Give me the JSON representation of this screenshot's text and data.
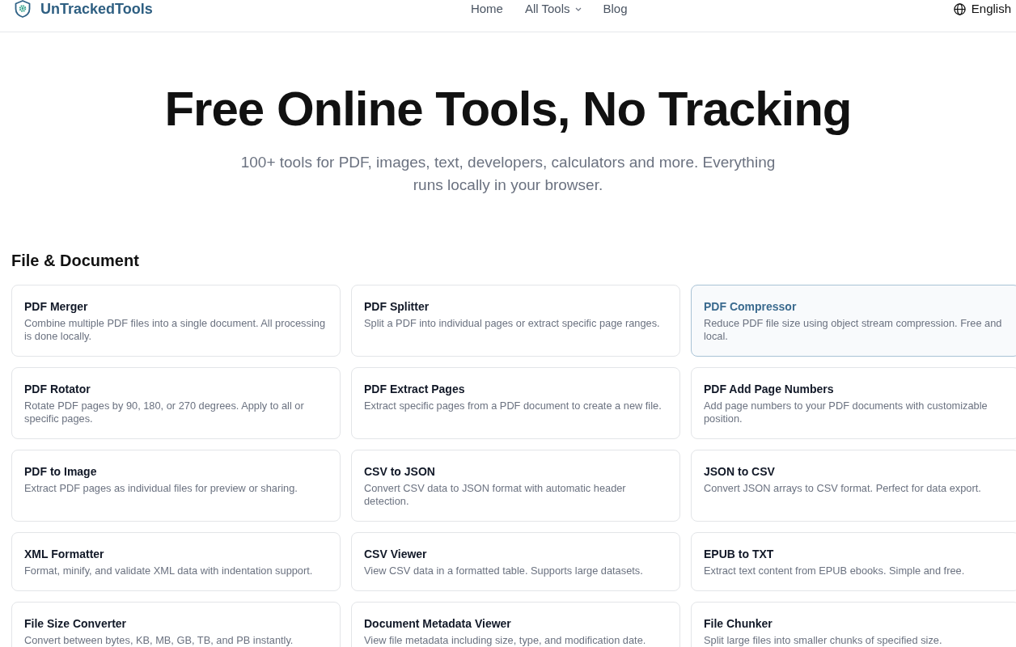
{
  "header": {
    "logo": {
      "text": "UnTrackedTools"
    },
    "nav": [
      {
        "label": "Home",
        "kind": "link"
      },
      {
        "label": "All Tools",
        "kind": "dropdown"
      },
      {
        "label": "Blog",
        "kind": "link"
      }
    ],
    "language": {
      "label": "English"
    }
  },
  "hero": {
    "title": "Free Online Tools, No Tracking",
    "subtitle": "100+ tools for PDF, images, text, developers, calculators and more. Everything runs locally in your browser."
  },
  "sections": [
    {
      "heading": "File & Document",
      "tools": [
        {
          "title": "PDF Merger",
          "description": "Combine multiple PDF files into a single document. All processing is done locally.",
          "highlighted": false
        },
        {
          "title": "PDF Splitter",
          "description": "Split a PDF into individual pages or extract specific page ranges.",
          "highlighted": false
        },
        {
          "title": "PDF Compressor",
          "description": "Reduce PDF file size using object stream compression. Free and local.",
          "highlighted": true
        },
        {
          "title": "PDF Rotator",
          "description": "Rotate PDF pages by 90, 180, or 270 degrees. Apply to all or specific pages.",
          "highlighted": false
        },
        {
          "title": "PDF Extract Pages",
          "description": "Extract specific pages from a PDF document to create a new file.",
          "highlighted": false
        },
        {
          "title": "PDF Add Page Numbers",
          "description": "Add page numbers to your PDF documents with customizable position.",
          "highlighted": false
        },
        {
          "title": "PDF to Image",
          "description": "Extract PDF pages as individual files for preview or sharing.",
          "highlighted": false
        },
        {
          "title": "CSV to JSON",
          "description": "Convert CSV data to JSON format with automatic header detection.",
          "highlighted": false
        },
        {
          "title": "JSON to CSV",
          "description": "Convert JSON arrays to CSV format. Perfect for data export.",
          "highlighted": false
        },
        {
          "title": "XML Formatter",
          "description": "Format, minify, and validate XML data with indentation support.",
          "highlighted": false
        },
        {
          "title": "CSV Viewer",
          "description": "View CSV data in a formatted table. Supports large datasets.",
          "highlighted": false
        },
        {
          "title": "EPUB to TXT",
          "description": "Extract text content from EPUB ebooks. Simple and free.",
          "highlighted": false
        },
        {
          "title": "File Size Converter",
          "description": "Convert between bytes, KB, MB, GB, TB, and PB instantly.",
          "highlighted": false
        },
        {
          "title": "Document Metadata Viewer",
          "description": "View file metadata including size, type, and modification date.",
          "highlighted": false
        },
        {
          "title": "File Chunker",
          "description": "Split large files into smaller chunks of specified size.",
          "highlighted": false
        }
      ]
    }
  ]
}
